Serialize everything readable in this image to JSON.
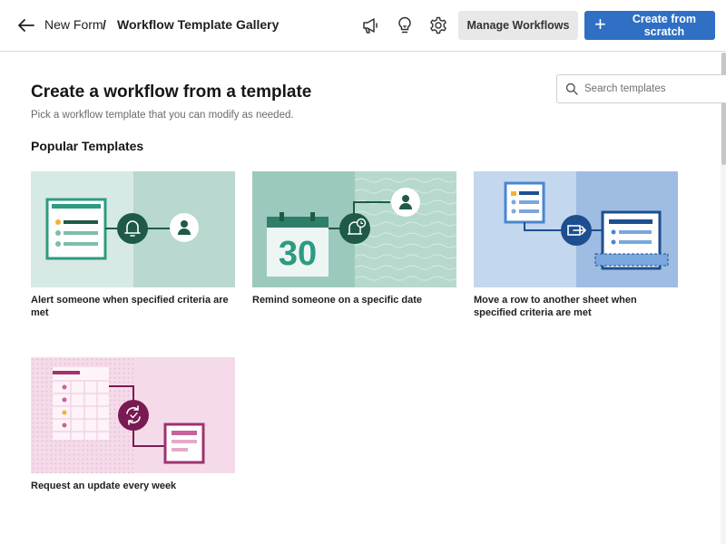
{
  "header": {
    "breadcrumb_parent": "New Form",
    "breadcrumb_separator": "/",
    "breadcrumb_current": "Workflow Template Gallery",
    "icons": [
      "back-arrow-icon",
      "megaphone-icon",
      "lightbulb-icon",
      "gear-icon"
    ],
    "manage_label": "Manage Workflows",
    "create_label": "Create from scratch",
    "create_icon": "plus-icon",
    "primary_color": "#2f6fc4"
  },
  "main": {
    "title": "Create a workflow from a template",
    "subtitle": "Pick a workflow template that you can modify as needed.",
    "section_title": "Popular Templates",
    "search": {
      "placeholder": "Search templates",
      "value": "",
      "icon": "search-icon"
    }
  },
  "templates": [
    {
      "label": "Alert someone when specified criteria are met",
      "icon": "bell-icon",
      "accent": "#1e5a47"
    },
    {
      "label": "Remind someone on a specific date",
      "icon": "alarm-clock-icon",
      "calendar_day": "30",
      "accent": "#1e5a47"
    },
    {
      "label": "Move a row to another sheet when specified criteria are met",
      "icon": "move-arrow-icon",
      "accent": "#1d4f8f"
    },
    {
      "label": "Request an update every week",
      "icon": "refresh-icon",
      "accent": "#7a1a53"
    }
  ]
}
